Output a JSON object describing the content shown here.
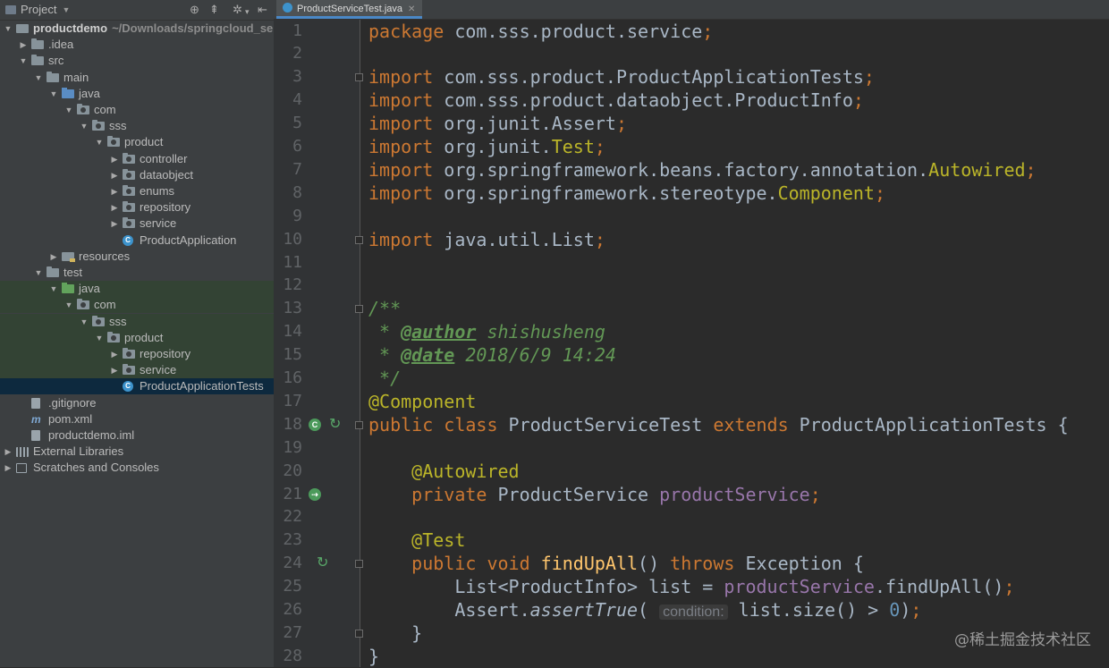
{
  "project_panel": {
    "title": "Project",
    "tree": [
      {
        "label": "productdemo",
        "path": "~/Downloads/springcloud_sell/p",
        "depth": 0,
        "expanded": true,
        "icon": "module-folder",
        "bold": true
      },
      {
        "label": ".idea",
        "depth": 1,
        "expanded": false,
        "icon": "folder"
      },
      {
        "label": "src",
        "depth": 1,
        "expanded": true,
        "icon": "folder"
      },
      {
        "label": "main",
        "depth": 2,
        "expanded": true,
        "icon": "folder"
      },
      {
        "label": "java",
        "depth": 3,
        "expanded": true,
        "icon": "source-folder"
      },
      {
        "label": "com",
        "depth": 4,
        "expanded": true,
        "icon": "package"
      },
      {
        "label": "sss",
        "depth": 5,
        "expanded": true,
        "icon": "package"
      },
      {
        "label": "product",
        "depth": 6,
        "expanded": true,
        "icon": "package"
      },
      {
        "label": "controller",
        "depth": 7,
        "expanded": false,
        "icon": "package"
      },
      {
        "label": "dataobject",
        "depth": 7,
        "expanded": false,
        "icon": "package"
      },
      {
        "label": "enums",
        "depth": 7,
        "expanded": false,
        "icon": "package"
      },
      {
        "label": "repository",
        "depth": 7,
        "expanded": false,
        "icon": "package"
      },
      {
        "label": "service",
        "depth": 7,
        "expanded": false,
        "icon": "package"
      },
      {
        "label": "ProductApplication",
        "depth": 7,
        "leaf": true,
        "icon": "spring-class"
      },
      {
        "label": "resources",
        "depth": 3,
        "expanded": false,
        "icon": "resources-folder"
      },
      {
        "label": "test",
        "depth": 2,
        "expanded": true,
        "icon": "folder"
      },
      {
        "label": "java",
        "depth": 3,
        "expanded": true,
        "icon": "test-folder",
        "test": true
      },
      {
        "label": "com",
        "depth": 4,
        "expanded": true,
        "icon": "package",
        "test": true
      },
      {
        "label": "sss",
        "depth": 5,
        "expanded": true,
        "icon": "package",
        "test": true
      },
      {
        "label": "product",
        "depth": 6,
        "expanded": true,
        "icon": "package",
        "test": true
      },
      {
        "label": "repository",
        "depth": 7,
        "expanded": false,
        "icon": "package",
        "test": true
      },
      {
        "label": "service",
        "depth": 7,
        "expanded": false,
        "icon": "package",
        "test": true
      },
      {
        "label": "ProductApplicationTests",
        "depth": 7,
        "leaf": true,
        "icon": "spring-class",
        "selected": true
      },
      {
        "label": ".gitignore",
        "depth": 1,
        "leaf": true,
        "icon": "file"
      },
      {
        "label": "pom.xml",
        "depth": 1,
        "leaf": true,
        "icon": "maven-file"
      },
      {
        "label": "productdemo.iml",
        "depth": 1,
        "leaf": true,
        "icon": "file"
      },
      {
        "label": "External Libraries",
        "depth": 0,
        "expanded": false,
        "icon": "libraries"
      },
      {
        "label": "Scratches and Consoles",
        "depth": 0,
        "expanded": false,
        "icon": "scratches"
      }
    ]
  },
  "editor": {
    "active_tab": "ProductServiceTest.java",
    "code_lines": [
      [
        [
          "kw",
          "package "
        ],
        [
          "",
          "com.sss.product.service"
        ],
        [
          "kw",
          ";"
        ]
      ],
      [],
      [
        [
          "kw",
          "import "
        ],
        [
          "",
          "com.sss.product.ProductApplicationTests"
        ],
        [
          "kw",
          ";"
        ]
      ],
      [
        [
          "kw",
          "import "
        ],
        [
          "",
          "com.sss.product.dataobject.ProductInfo"
        ],
        [
          "kw",
          ";"
        ]
      ],
      [
        [
          "kw",
          "import "
        ],
        [
          "",
          "org.junit.Assert"
        ],
        [
          "kw",
          ";"
        ]
      ],
      [
        [
          "kw",
          "import "
        ],
        [
          "",
          "org.junit."
        ],
        [
          "ann",
          "Test"
        ],
        [
          "kw",
          ";"
        ]
      ],
      [
        [
          "kw",
          "import "
        ],
        [
          "",
          "org.springframework.beans.factory.annotation."
        ],
        [
          "ann",
          "Autowired"
        ],
        [
          "kw",
          ";"
        ]
      ],
      [
        [
          "kw",
          "import "
        ],
        [
          "",
          "org.springframework.stereotype."
        ],
        [
          "ann",
          "Component"
        ],
        [
          "kw",
          ";"
        ]
      ],
      [],
      [
        [
          "kw",
          "import "
        ],
        [
          "",
          "java.util.List"
        ],
        [
          "kw",
          ";"
        ]
      ],
      [],
      [],
      [
        [
          "cmt",
          "/**"
        ]
      ],
      [
        [
          "cmt",
          " * "
        ],
        [
          "doctag",
          "@author"
        ],
        [
          "cmt",
          " shishusheng"
        ]
      ],
      [
        [
          "cmt",
          " * "
        ],
        [
          "doctag",
          "@date"
        ],
        [
          "cmt",
          " 2018/6/9 14:24"
        ]
      ],
      [
        [
          "cmt",
          " */"
        ]
      ],
      [
        [
          "ann",
          "@Component"
        ]
      ],
      [
        [
          "kw",
          "public class "
        ],
        [
          "",
          "ProductServiceTest "
        ],
        [
          "kw",
          "extends "
        ],
        [
          "",
          "ProductApplicationTests {"
        ]
      ],
      [],
      [
        [
          "",
          "    "
        ],
        [
          "ann",
          "@Autowired"
        ]
      ],
      [
        [
          "",
          "    "
        ],
        [
          "kw",
          "private "
        ],
        [
          "",
          "ProductService "
        ],
        [
          "fld",
          "productService"
        ],
        [
          "kw",
          ";"
        ]
      ],
      [],
      [
        [
          "",
          "    "
        ],
        [
          "ann",
          "@Test"
        ]
      ],
      [
        [
          "",
          "    "
        ],
        [
          "kw",
          "public void "
        ],
        [
          "fn",
          "findUpAll"
        ],
        [
          "",
          "() "
        ],
        [
          "kw",
          "throws "
        ],
        [
          "",
          "Exception {"
        ]
      ],
      [
        [
          "",
          "        List<ProductInfo> list = "
        ],
        [
          "fld",
          "productService"
        ],
        [
          "",
          ".findUpAll()"
        ],
        [
          "kw",
          ";"
        ]
      ],
      [
        [
          "",
          "        Assert."
        ],
        [
          "ital",
          "assertTrue"
        ],
        [
          "",
          "( "
        ],
        [
          "hint",
          "condition:"
        ],
        [
          "",
          " list.size() > "
        ],
        [
          "num",
          "0"
        ],
        [
          "",
          ")"
        ],
        [
          "kw",
          ";"
        ]
      ],
      [
        [
          "",
          "    }"
        ]
      ],
      [
        [
          "",
          "}"
        ]
      ]
    ],
    "gutter_icons": [
      {
        "line": 18,
        "icons": [
          "spring-bean-icon",
          "run-test-icon"
        ]
      },
      {
        "line": 21,
        "icons": [
          "autowired-bean-icon"
        ]
      },
      {
        "line": 24,
        "icons": [
          "run-test-icon"
        ]
      }
    ],
    "fold_markers": [
      3,
      10,
      13,
      18,
      24,
      27
    ]
  },
  "watermark": "@稀土掘金技术社区"
}
